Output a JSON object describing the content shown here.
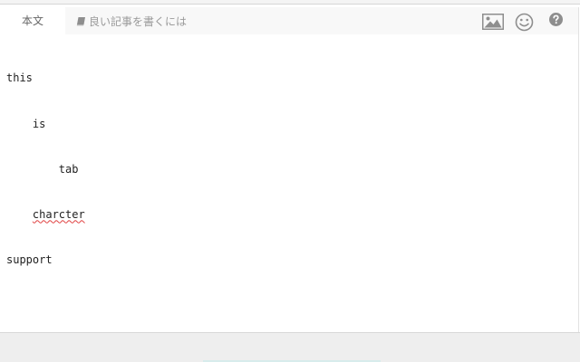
{
  "tabs": {
    "body_label": "本文",
    "guide_label": "良い記事を書くには"
  },
  "toolbar": {
    "image_icon": "image-icon",
    "emoji_icon": "smiley-icon",
    "help_icon": "question-icon"
  },
  "editor": {
    "lines": [
      "this",
      "    is",
      "        tab",
      "    charcter",
      "support"
    ]
  },
  "colors": {
    "accent_footer": "#d7ecec",
    "spellcheck": "#e04040"
  }
}
